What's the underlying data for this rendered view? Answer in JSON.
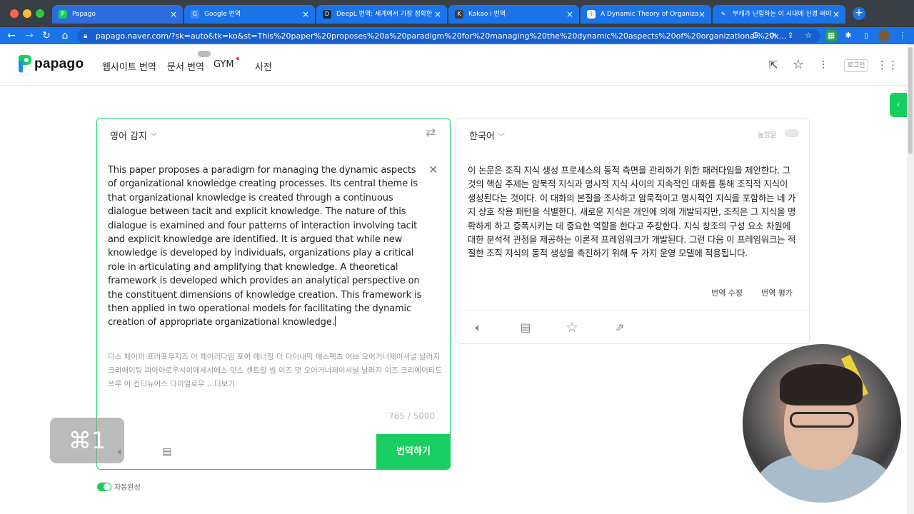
{
  "browser": {
    "tabs": [
      {
        "title": "Papago",
        "fav": "P",
        "favcolor": "#19ce60"
      },
      {
        "title": "Google 번역",
        "fav": "G",
        "favcolor": "#4285f4"
      },
      {
        "title": "DeepL 번역: 세계에서 가장 정확한",
        "fav": "D",
        "favcolor": "#0f2b46"
      },
      {
        "title": "Kakao i 번역",
        "fav": "K",
        "favcolor": "#3c3c3c"
      },
      {
        "title": "A Dynamic Theory of Organiza",
        "fav": "i",
        "favcolor": "#f5f5f5"
      },
      {
        "title": "부캐가 난립하는 이 시대에 신경 써야",
        "fav": "✎",
        "favcolor": "#1a73e8"
      }
    ],
    "url": "papago.naver.com/?sk=auto&tk=ko&st=This%20paper%20proposes%20a%20paradigm%20for%20managing%20the%20dynamic%20aspects%20of%20organizational%20k..."
  },
  "header": {
    "logo": "papago",
    "nav": {
      "website": "웹사이트 번역",
      "document": "문서 번역",
      "gym": "GYM",
      "dictionary": "사전"
    },
    "login": "로그인"
  },
  "source": {
    "language": "영어 감지",
    "text": "This paper proposes a paradigm for managing the dynamic aspects of organizational knowledge creating processes. Its central theme is that organizational knowledge is created through a continuous dialogue between tacit and explicit knowledge. The nature of this dialogue is examined and four patterns of interaction involving tacit and explicit knowledge are identified. It is argued that while new knowledge is developed by individuals, organizations play a critical role in articulating and amplifying that knowledge. A theoretical framework is developed which provides an analytical perspective on the constituent dimensions of knowledge creation. This framework is then applied in two operational models for facilitating the dynamic creation of appropriate organizational knowledge.",
    "pronunciation": "디스 페이퍼 프러포우지즈 어 페어러다임 포어 매너징 더 다이내믹 애스펙츠 어브 오어거너제이셔널 날러지 크리에이팅 피아아로우시이에세시에스 잇스 센트럴 씸 이즈 댓 오어거너제이셔널 날러지 이즈 크리에이티드 쓰루 어 컨티뉴어스 다이얼로우 ...더보기",
    "count": "785 / 5000",
    "translate_button": "번역하기",
    "autocomplete": "자동완성"
  },
  "target": {
    "language": "한국어",
    "honorific": "높임말",
    "text": "이 논문은 조직 지식 생성 프로세스의 동적 측면을 관리하기 위한 패러다임을 제안한다. 그것의 핵심 주제는 암묵적 지식과 명시적 지식 사이의 지속적인 대화를 통해 조직적 지식이 생성된다는 것이다. 이 대화의 본질을 조사하고 암묵적이고 명시적인 지식을 포함하는 네 가지 상호 작용 패턴을 식별한다. 새로운 지식은 개인에 의해 개발되지만, 조직은 그 지식을 명확하게 하고 증폭시키는 데 중요한 역할을 한다고 주장한다. 지식 창조의 구성 요소 차원에 대한 분석적 관점을 제공하는 이론적 프레임워크가 개발된다. 그런 다음 이 프레임워크는 적절한 조직 지식의 동적 생성을 촉진하기 위해 두 가지 운영 모델에 적용됩니다.",
    "edit": "번역 수정",
    "rate": "번역 평가"
  },
  "overlay": {
    "shortcut": "⌘1"
  },
  "colors": {
    "brand_green": "#19ce60",
    "browser_blue": "#1a73e8"
  }
}
